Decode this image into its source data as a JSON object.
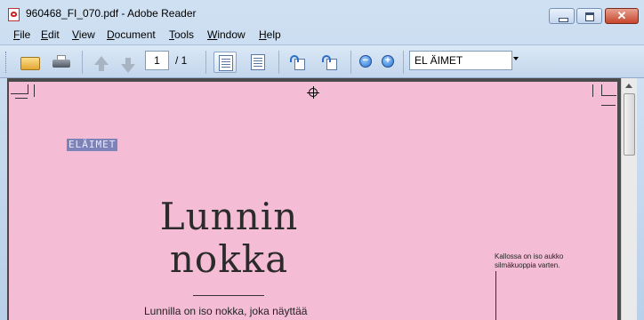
{
  "window": {
    "title": "960468_FI_070.pdf - Adobe Reader",
    "controls": {
      "minimize": "",
      "maximize": "",
      "close": "✕"
    }
  },
  "menu": {
    "items": [
      {
        "label": "File",
        "accel": "F",
        "rest": "ile"
      },
      {
        "label": "Edit",
        "accel": "E",
        "rest": "dit"
      },
      {
        "label": "View",
        "accel": "V",
        "rest": "iew"
      },
      {
        "label": "Document",
        "accel": "D",
        "rest": "ocument"
      },
      {
        "label": "Tools",
        "accel": "T",
        "rest": "ools"
      },
      {
        "label": "Window",
        "accel": "W",
        "rest": "indow"
      },
      {
        "label": "Help",
        "accel": "H",
        "rest": "elp"
      }
    ],
    "close_doc": "×"
  },
  "toolbar": {
    "page_current": "1",
    "page_total": "/ 1",
    "zoom_out": "−",
    "zoom_in": "+",
    "search_value": "EL ÄIMET"
  },
  "document": {
    "section_label": "ELÄIMET",
    "headline_line1": "Lunnin",
    "headline_line2": "nokka",
    "body_text": "Lunnilla on iso nokka, joka näyttää",
    "annotation": "Kallossa on iso aukko silmäkuoppia varten."
  }
}
